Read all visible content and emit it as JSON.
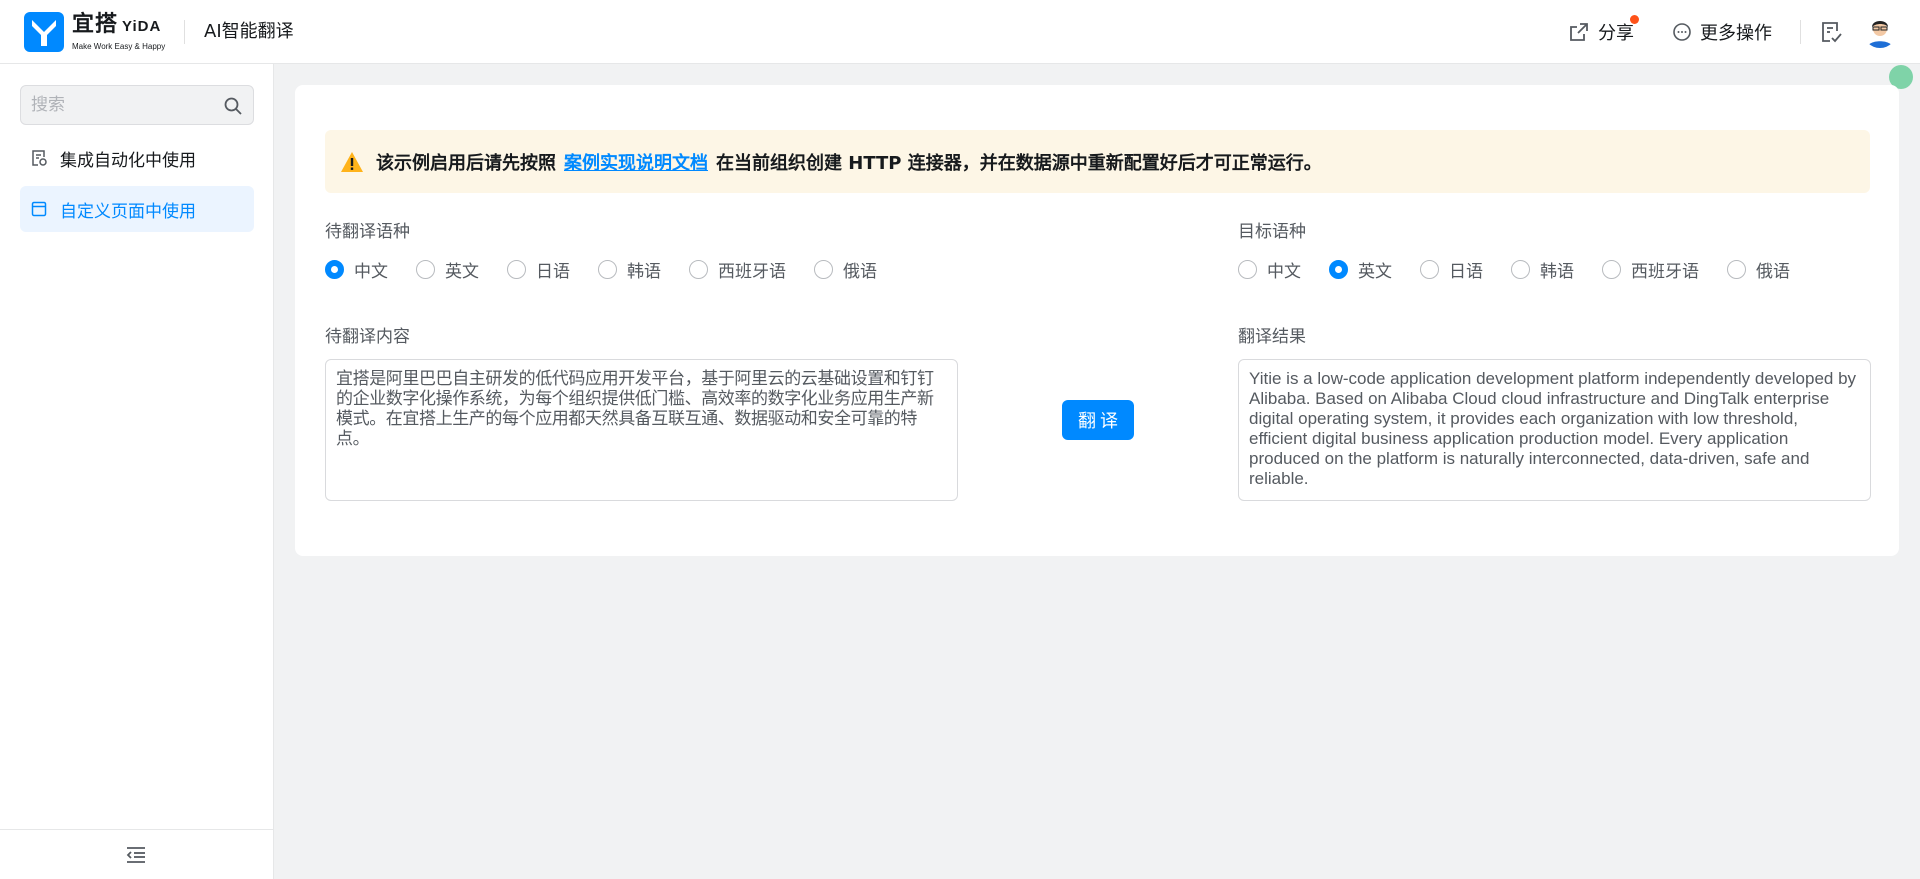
{
  "header": {
    "brand_name": "宜搭",
    "brand_name_en": "YiDA",
    "brand_slogan": "Make Work Easy & Happy",
    "app_title": "AI智能翻译",
    "share_label": "分享",
    "more_label": "更多操作"
  },
  "sidebar": {
    "search_placeholder": "搜索",
    "items": [
      {
        "label": "集成自动化中使用",
        "active": false
      },
      {
        "label": "自定义页面中使用",
        "active": true
      }
    ]
  },
  "notice": {
    "prefix": "该示例启用后请先按照",
    "link": "案例实现说明文档",
    "suffix": "在当前组织创建 HTTP 连接器，并在数据源中重新配置好后才可正常运行。"
  },
  "source": {
    "lang_label": "待翻译语种",
    "content_label": "待翻译内容",
    "languages": [
      "中文",
      "英文",
      "日语",
      "韩语",
      "西班牙语",
      "俄语"
    ],
    "selected": "中文",
    "text": "宜搭是阿里巴巴自主研发的低代码应用开发平台，基于阿里云的云基础设置和钉钉的企业数字化操作系统，为每个组织提供低门槛、高效率的数字化业务应用生产新模式。在宜搭上生产的每个应用都天然具备互联互通、数据驱动和安全可靠的特点。"
  },
  "target": {
    "lang_label": "目标语种",
    "content_label": "翻译结果",
    "languages": [
      "中文",
      "英文",
      "日语",
      "韩语",
      "西班牙语",
      "俄语"
    ],
    "selected": "英文",
    "text": "Yitie is a low-code application development platform independently developed by Alibaba. Based on Alibaba Cloud cloud infrastructure and DingTalk enterprise digital operating system, it provides each organization with low threshold, efficient digital business application production model. Every application produced on the platform is naturally interconnected, data-driven, safe and reliable."
  },
  "translate_button": "翻译",
  "colors": {
    "primary": "#0089ff",
    "notice_bg": "#fdf6e6",
    "badge_dot": "#ff5219",
    "active_nav_bg": "#ebf4ff"
  }
}
